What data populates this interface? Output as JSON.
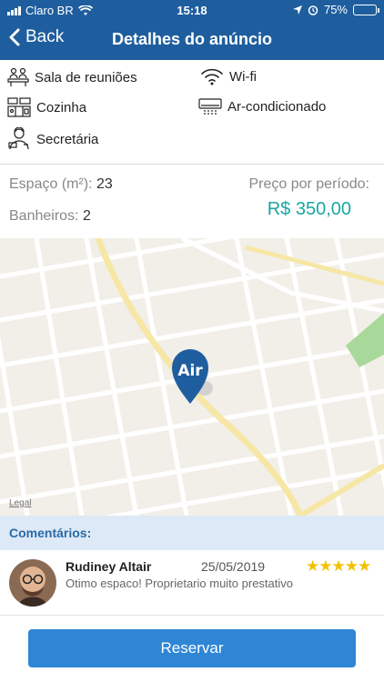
{
  "status": {
    "carrier": "Claro BR",
    "time": "15:18",
    "battery": "75%",
    "battery_level": 0.75
  },
  "nav": {
    "back_label": "Back",
    "title": "Detalhes do anúncio"
  },
  "amenities": [
    {
      "label": "Sala de reuniões",
      "icon": "meeting-room-icon"
    },
    {
      "label": "Wi-fi",
      "icon": "wifi-icon"
    },
    {
      "label": "Cozinha",
      "icon": "kitchen-icon"
    },
    {
      "label": "Ar-condicionado",
      "icon": "air-conditioner-icon"
    },
    {
      "label": "Secretária",
      "icon": "secretary-icon"
    }
  ],
  "info": {
    "space_label": "Espaço (m²):",
    "space_value": "23",
    "bath_label": "Banheiros:",
    "bath_value": "2",
    "price_label": "Preço por período:",
    "price_value": "R$ 350,00"
  },
  "map": {
    "pin_label": "Air",
    "legal": "Legal"
  },
  "comments": {
    "header": "Comentários:",
    "items": [
      {
        "author": "Rudiney Altair",
        "date": "25/05/2019",
        "rating": 5,
        "stars": "★★★★★",
        "text": "Otimo espaco! Proprietario muito prestativo"
      }
    ]
  },
  "actions": {
    "reserve_label": "Reservar"
  },
  "colors": {
    "nav": "#1f5e9e",
    "price": "#1aa7a1",
    "button": "#2f86d5",
    "stars": "#f2c200",
    "comments_header": "#dde9f6"
  }
}
